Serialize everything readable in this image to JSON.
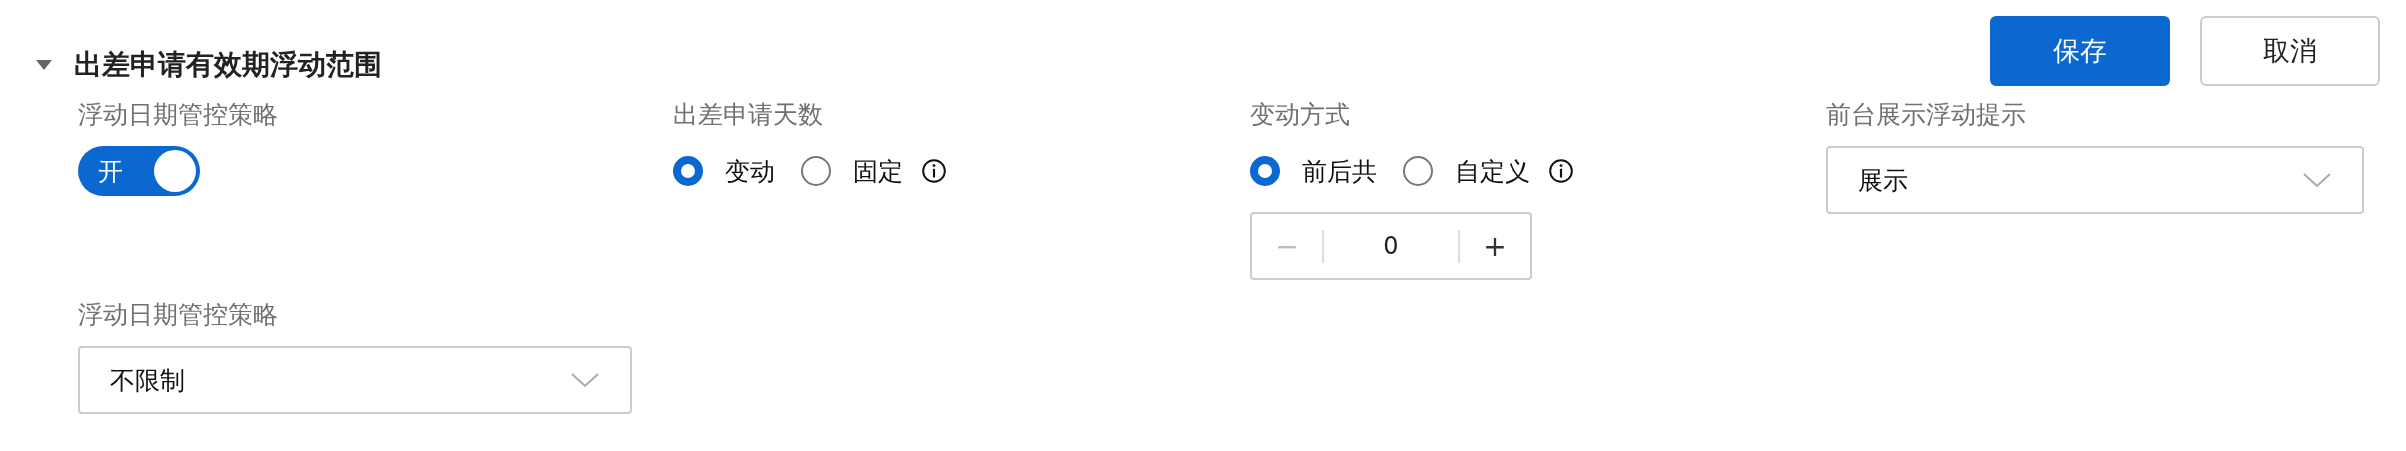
{
  "section": {
    "title": "出差申请有效期浮动范围",
    "expanded": true
  },
  "buttons": [
    {
      "label": "保存",
      "kind": "primary"
    },
    {
      "label": "取消",
      "kind": "default"
    }
  ],
  "rows": [
    {
      "fields": [
        {
          "kind": "toggle",
          "label": "浮动日期管控策略",
          "on": true,
          "text": "开"
        },
        {
          "kind": "radio",
          "label": "出差申请天数",
          "info": true,
          "options": [
            {
              "label": "变动",
              "selected": true
            },
            {
              "label": "固定",
              "selected": false
            }
          ]
        },
        {
          "kind": "radio",
          "label": "变动方式",
          "info": true,
          "options": [
            {
              "label": "前后共",
              "selected": true
            },
            {
              "label": "自定义",
              "selected": false
            }
          ],
          "stepper": {
            "value": "0",
            "minus": "−",
            "plus": "+"
          }
        },
        {
          "kind": "select",
          "label": "前台展示浮动提示",
          "value": "展示"
        }
      ]
    },
    {
      "fields": [
        {
          "kind": "select",
          "label": "浮动日期管控策略",
          "value": "不限制"
        }
      ]
    }
  ]
}
